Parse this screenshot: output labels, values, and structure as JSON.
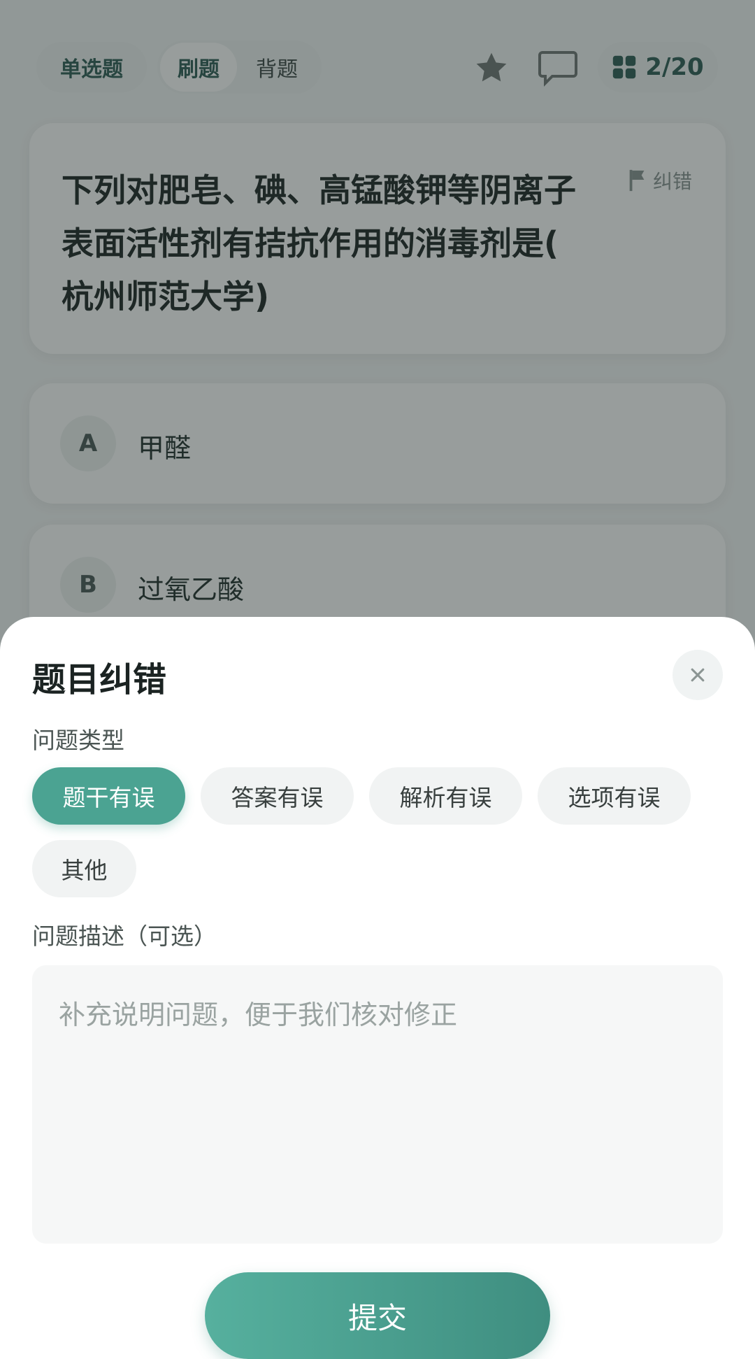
{
  "header": {
    "type_label": "单选题",
    "mode_practice": "刷题",
    "mode_memorize": "背题",
    "progress": "2/20"
  },
  "question": {
    "text": "下列对肥皂、碘、高锰酸钾等阴离子\n表面活性剂有拮抗作用的消毒剂是(\n杭州师范大学)",
    "report_label": "纠错"
  },
  "options": [
    {
      "letter": "A",
      "text": "甲醛"
    },
    {
      "letter": "B",
      "text": "过氧乙酸"
    }
  ],
  "sheet": {
    "title": "题目纠错",
    "type_label": "问题类型",
    "chips": [
      "题干有误",
      "答案有误",
      "解析有误",
      "选项有误",
      "其他"
    ],
    "selected_chip": "题干有误",
    "desc_label": "问题描述（可选）",
    "desc_placeholder": "补充说明问题，便于我们核对修正",
    "desc_value": "",
    "submit_label": "提交"
  },
  "colors": {
    "accent": "#4ba392",
    "accent_dark": "#2f5d55",
    "overlay": "#1e2a28"
  }
}
